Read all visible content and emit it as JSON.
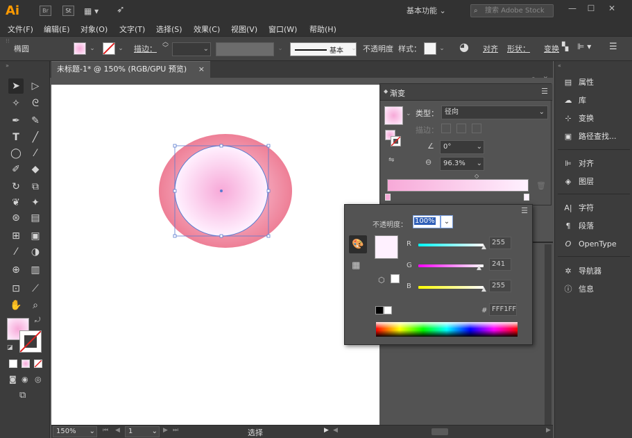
{
  "app": {
    "logo": "Ai",
    "bridge": "Br",
    "stock_icon": "St"
  },
  "titlebar": {
    "workspace": "基本功能",
    "search_placeholder": "搜索 Adobe Stock"
  },
  "menu": [
    "文件(F)",
    "编辑(E)",
    "对象(O)",
    "文字(T)",
    "选择(S)",
    "效果(C)",
    "视图(V)",
    "窗口(W)",
    "帮助(H)"
  ],
  "control": {
    "object_label": "椭圆",
    "stroke_label": "描边：",
    "stroke_style": "基本",
    "opacity_label": "不透明度",
    "style_label": "样式：",
    "align_label": "对齐",
    "shape_label": "形状：",
    "transform_label": "变换"
  },
  "document": {
    "tab_title": "未标题-1* @ 150% (RGB/GPU 预览)",
    "close": "×"
  },
  "status": {
    "zoom": "150%",
    "artboard": "1",
    "tool": "选择"
  },
  "gradient_panel": {
    "title": "渐变",
    "type_label": "类型：",
    "type_value": "径向",
    "stroke_label": "描边：",
    "angle_value": "0°",
    "aspect_value": "96.3%",
    "colors": {
      "start": "#f7a9d8",
      "end": "#fff1ff"
    }
  },
  "color_panel": {
    "opacity_label": "不透明度：",
    "opacity_value": "100%",
    "r_label": "R",
    "r_value": "255",
    "g_label": "G",
    "g_value": "241",
    "b_label": "B",
    "b_value": "255",
    "hex_label": "#",
    "hex_value": "FFF1FF",
    "current_color": "#fff1ff"
  },
  "right_dock": [
    {
      "icon": "properties-icon",
      "label": "属性"
    },
    {
      "icon": "libraries-icon",
      "label": "库"
    },
    {
      "icon": "transform-icon",
      "label": "变换"
    },
    {
      "icon": "pathfinder-icon",
      "label": "路径查找..."
    },
    {
      "icon": "align-icon",
      "label": "对齐"
    },
    {
      "icon": "layers-icon",
      "label": "图层"
    },
    {
      "icon": "character-icon",
      "label": "字符"
    },
    {
      "icon": "paragraph-icon",
      "label": "段落"
    },
    {
      "icon": "opentype-icon",
      "label": "OpenType"
    },
    {
      "icon": "navigator-icon",
      "label": "导航器"
    },
    {
      "icon": "info-icon",
      "label": "信息"
    }
  ]
}
